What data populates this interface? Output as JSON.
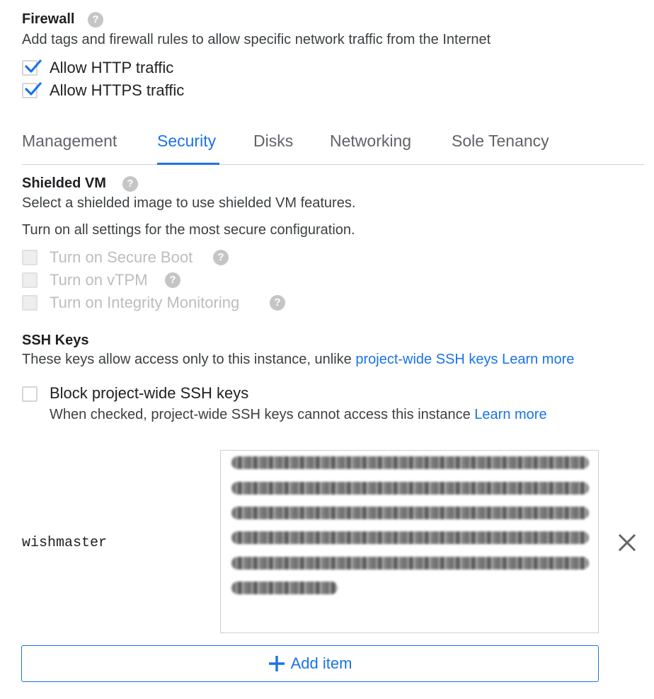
{
  "firewall": {
    "title": "Firewall",
    "description": "Add tags and firewall rules to allow specific network traffic from the Internet",
    "options": [
      {
        "label": "Allow HTTP traffic",
        "checked": true
      },
      {
        "label": "Allow HTTPS traffic",
        "checked": true
      }
    ]
  },
  "tabs": {
    "items": [
      {
        "label": "Management",
        "active": false
      },
      {
        "label": "Security",
        "active": true
      },
      {
        "label": "Disks",
        "active": false
      },
      {
        "label": "Networking",
        "active": false
      },
      {
        "label": "Sole Tenancy",
        "active": false
      }
    ]
  },
  "shielded_vm": {
    "title": "Shielded VM",
    "line1": "Select a shielded image to use shielded VM features.",
    "line2": "Turn on all settings for the most secure configuration.",
    "options": [
      {
        "label": "Turn on Secure Boot",
        "checked": false,
        "disabled": true
      },
      {
        "label": "Turn on vTPM",
        "checked": false,
        "disabled": true
      },
      {
        "label": "Turn on Integrity Monitoring",
        "checked": false,
        "disabled": true
      }
    ]
  },
  "ssh_keys": {
    "title": "SSH Keys",
    "description": "These keys allow access only to this instance, unlike",
    "project_link": "project-wide SSH keys",
    "learn_more": "Learn more",
    "block_label": "Block project-wide SSH keys",
    "block_checked": false,
    "block_hint": "When checked, project-wide SSH keys cannot access this instance",
    "block_learn_more": "Learn more",
    "key": {
      "username": "wishmaster"
    },
    "add_item_label": "Add item"
  },
  "colors": {
    "accent": "#1a73e8",
    "help_icon": "#c5c5c5",
    "disabled_text": "#bdbdbd"
  },
  "icons": {
    "help": "question-mark-circle-icon",
    "check": "checkmark-icon",
    "remove": "close-x-icon",
    "add": "plus-icon"
  }
}
